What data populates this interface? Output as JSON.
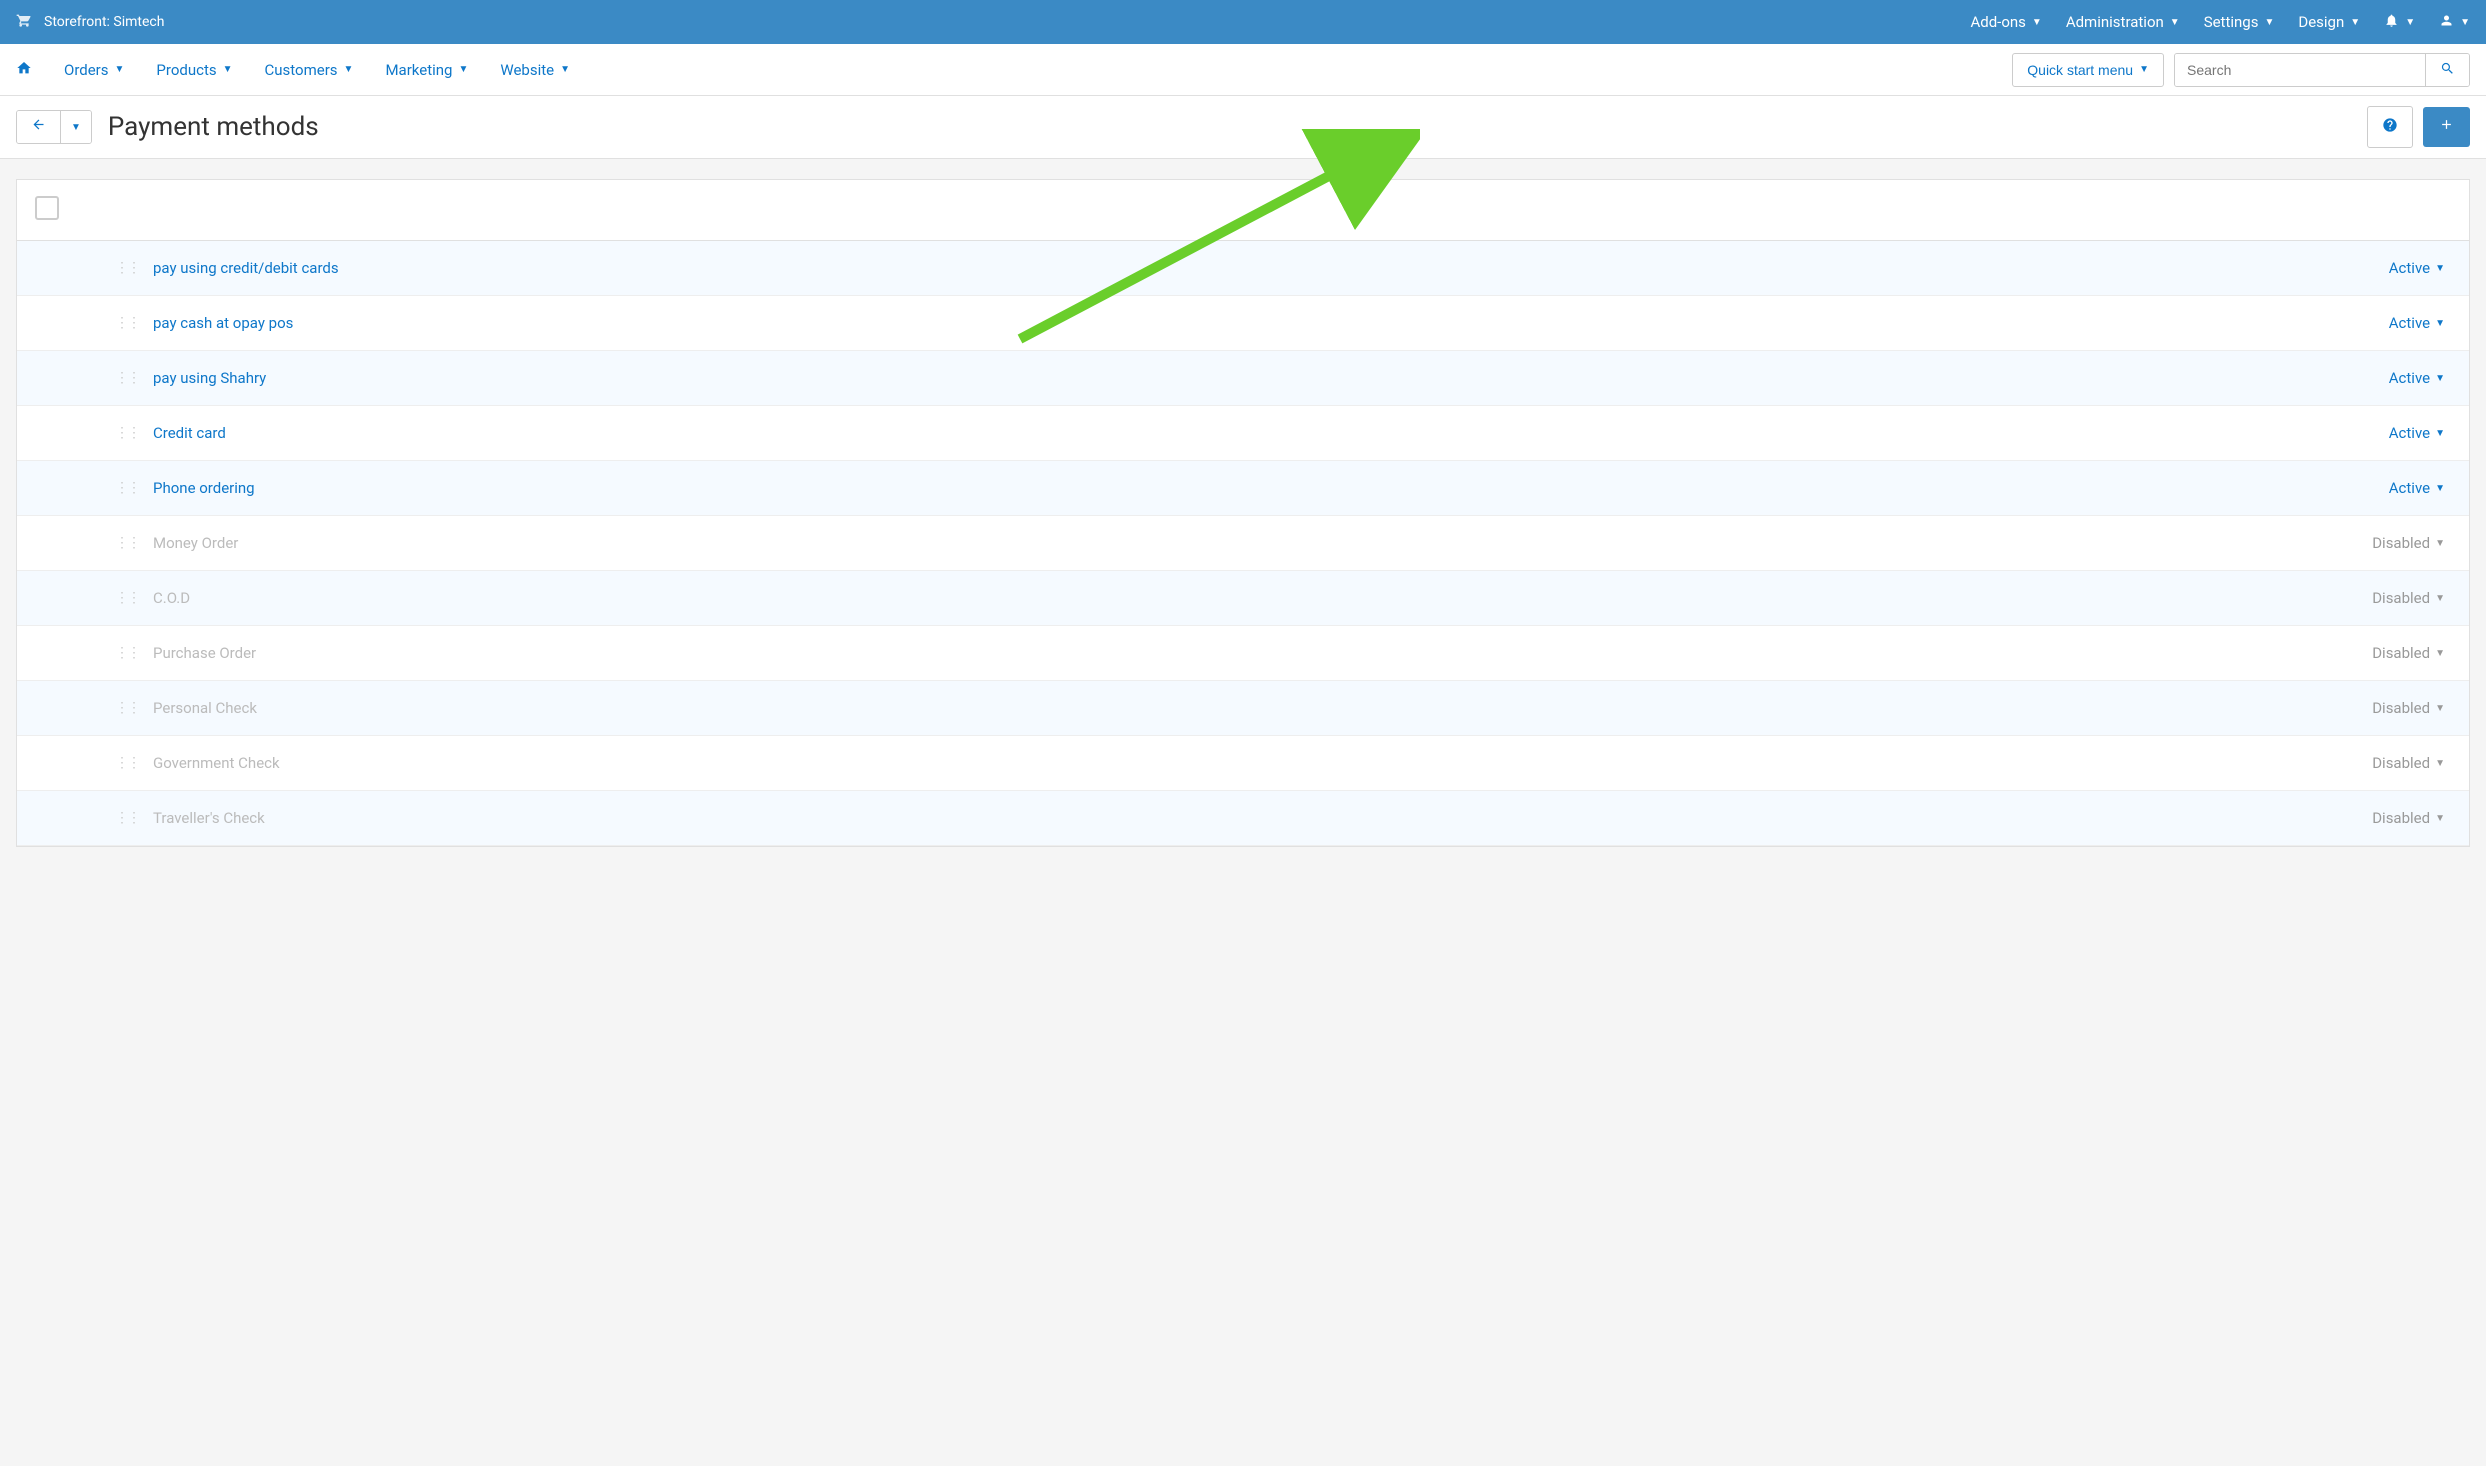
{
  "top_bar": {
    "storefront_label": "Storefront: Simtech",
    "menus": {
      "addons": "Add-ons",
      "administration": "Administration",
      "settings": "Settings",
      "design": "Design"
    }
  },
  "main_nav": {
    "items": {
      "orders": "Orders",
      "products": "Products",
      "customers": "Customers",
      "marketing": "Marketing",
      "website": "Website"
    },
    "quick_start_label": "Quick start menu",
    "search_placeholder": "Search"
  },
  "page": {
    "title": "Payment methods"
  },
  "status_labels": {
    "active": "Active",
    "disabled": "Disabled"
  },
  "rows": [
    {
      "name": "pay using credit/debit cards",
      "status": "active"
    },
    {
      "name": "pay cash at opay pos",
      "status": "active"
    },
    {
      "name": "pay using Shahry",
      "status": "active"
    },
    {
      "name": "Credit card",
      "status": "active"
    },
    {
      "name": "Phone ordering",
      "status": "active"
    },
    {
      "name": "Money Order",
      "status": "disabled"
    },
    {
      "name": "C.O.D",
      "status": "disabled"
    },
    {
      "name": "Purchase Order",
      "status": "disabled"
    },
    {
      "name": "Personal Check",
      "status": "disabled"
    },
    {
      "name": "Government Check",
      "status": "disabled"
    },
    {
      "name": "Traveller's Check",
      "status": "disabled"
    }
  ]
}
